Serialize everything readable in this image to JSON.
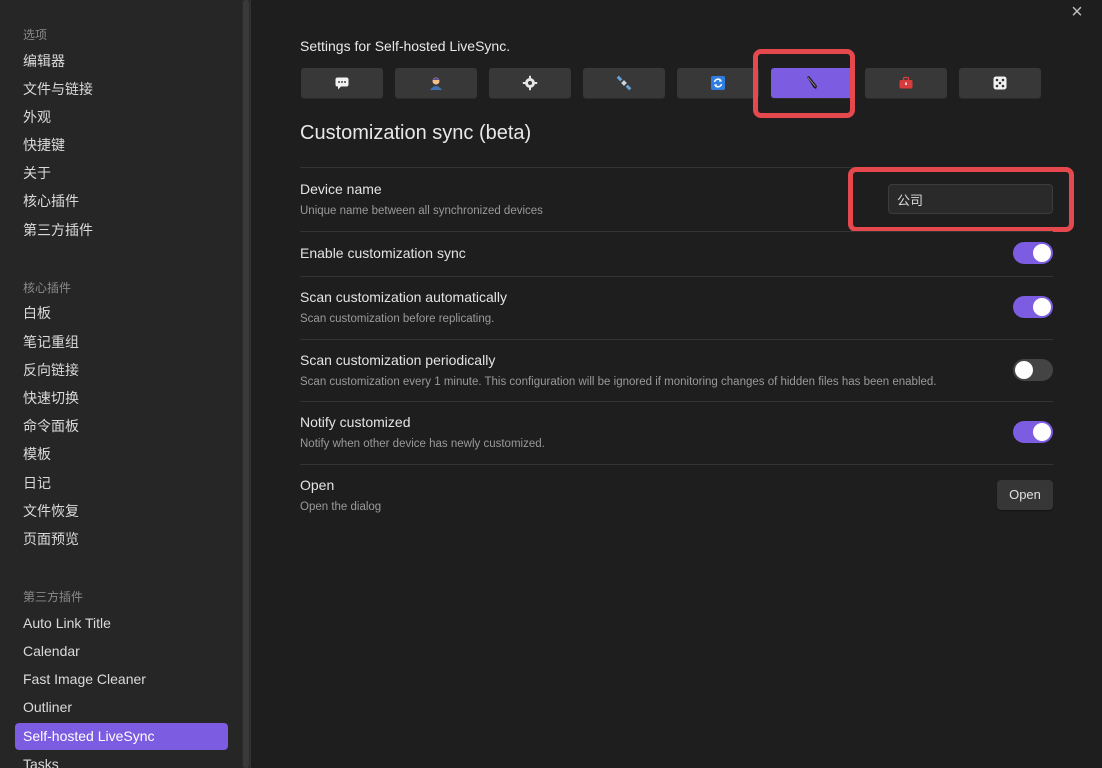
{
  "sidebar": {
    "options_title": "选项",
    "options": [
      "编辑器",
      "文件与链接",
      "外观",
      "快捷键",
      "关于",
      "核心插件",
      "第三方插件"
    ],
    "core_title": "核心插件",
    "core": [
      "白板",
      "笔记重组",
      "反向链接",
      "快速切换",
      "命令面板",
      "模板",
      "日记",
      "文件恢复",
      "页面预览"
    ],
    "community_title": "第三方插件",
    "community": [
      "Auto Link Title",
      "Calendar",
      "Fast Image Cleaner",
      "Outliner",
      "Self-hosted LiveSync",
      "Tasks"
    ],
    "active_item": "Self-hosted LiveSync"
  },
  "main": {
    "close_glyph": "×",
    "heading": "Settings for Self-hosted LiveSync.",
    "tabs": [
      {
        "icon": "chat-icon"
      },
      {
        "icon": "user-icon"
      },
      {
        "icon": "gear-icon"
      },
      {
        "icon": "satellite-icon"
      },
      {
        "icon": "sync-icon"
      },
      {
        "icon": "pen-icon",
        "active": true
      },
      {
        "icon": "toolbox-icon"
      },
      {
        "icon": "dice-icon"
      }
    ],
    "section_title": "Customization sync (beta)",
    "settings": {
      "device_name": {
        "name": "Device name",
        "desc": "Unique name between all synchronized devices",
        "value": "公司"
      },
      "enable_sync": {
        "name": "Enable customization sync",
        "enabled": true
      },
      "scan_auto": {
        "name": "Scan customization automatically",
        "desc": "Scan customization before replicating.",
        "enabled": true
      },
      "scan_periodic": {
        "name": "Scan customization periodically",
        "desc": "Scan customization every 1 minute. This configuration will be ignored if monitoring changes of hidden files has been enabled.",
        "enabled": false
      },
      "notify": {
        "name": "Notify customized",
        "desc": "Notify when other device has newly customized.",
        "enabled": true
      },
      "open": {
        "name": "Open",
        "desc": "Open the dialog",
        "button": "Open"
      }
    }
  },
  "colors": {
    "accent": "#7c5ce0",
    "highlight": "#e5484d"
  }
}
